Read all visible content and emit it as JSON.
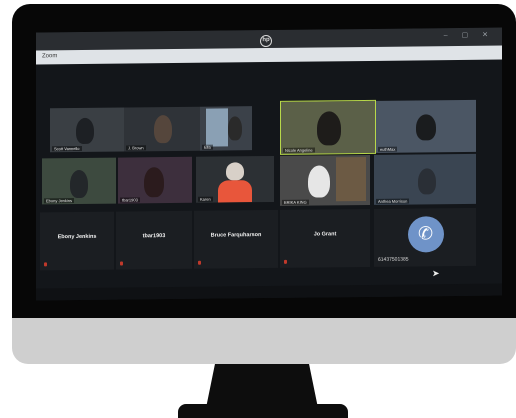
{
  "window": {
    "brand_logo": "hp",
    "controls": "– ▢ ✕",
    "app_name": "Zoom"
  },
  "participants": [
    {
      "label": "Scott Vannello"
    },
    {
      "label": "J. Brown"
    },
    {
      "label": "Ella"
    },
    {
      "label": "Nicole Angeline"
    },
    {
      "label": "euthMax"
    },
    {
      "label": "Ebony Jenkins"
    },
    {
      "label": "tbar1903"
    },
    {
      "label": "Karen"
    },
    {
      "label": "ERIKA KING"
    },
    {
      "label": "Anthea Morrison"
    }
  ],
  "name_tiles": [
    {
      "name": "Ebony Jenkins"
    },
    {
      "name": "tbar1903"
    },
    {
      "name": "Bruce Farquharson"
    },
    {
      "name": "Jo Grant"
    }
  ],
  "call": {
    "icon": "phone-icon",
    "number": "61437501385"
  },
  "colors": {
    "active_speaker_border": "#b8d84a",
    "call_button": "#6f93c8"
  }
}
